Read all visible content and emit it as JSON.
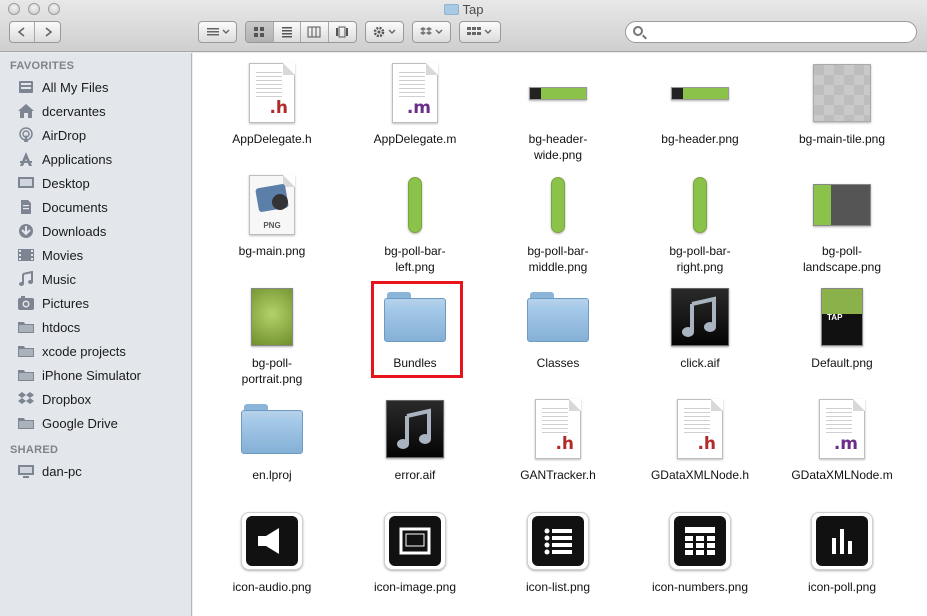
{
  "window": {
    "title": "Tap"
  },
  "toolbar": {
    "back_icon": "chevron-left-icon",
    "forward_icon": "chevron-right-icon",
    "arrange_icon": "list-arrange-icon",
    "view_modes": [
      "icon-view",
      "list-view",
      "column-view",
      "cover-flow-view"
    ],
    "action_icon": "gear-icon",
    "dropbox_icon": "dropbox-icon",
    "arrange_by_icon": "grid-arrange-icon",
    "search": {
      "placeholder": ""
    }
  },
  "sidebar": {
    "favorites_header": "FAVORITES",
    "favorites": [
      {
        "label": "All My Files",
        "icon": "all-files-icon"
      },
      {
        "label": "dcervantes",
        "icon": "home-icon"
      },
      {
        "label": "AirDrop",
        "icon": "airdrop-icon"
      },
      {
        "label": "Applications",
        "icon": "applications-icon"
      },
      {
        "label": "Desktop",
        "icon": "desktop-icon"
      },
      {
        "label": "Documents",
        "icon": "documents-icon"
      },
      {
        "label": "Downloads",
        "icon": "downloads-icon"
      },
      {
        "label": "Movies",
        "icon": "movies-icon"
      },
      {
        "label": "Music",
        "icon": "music-icon"
      },
      {
        "label": "Pictures",
        "icon": "pictures-icon"
      },
      {
        "label": "htdocs",
        "icon": "folder-icon"
      },
      {
        "label": "xcode projects",
        "icon": "folder-icon"
      },
      {
        "label": "iPhone Simulator",
        "icon": "folder-icon"
      },
      {
        "label": "Dropbox",
        "icon": "dropbox-icon"
      },
      {
        "label": "Google Drive",
        "icon": "folder-icon"
      }
    ],
    "shared_header": "SHARED",
    "shared": [
      {
        "label": "dan-pc",
        "icon": "computer-icon"
      }
    ]
  },
  "files": [
    {
      "line1": "AppDelegate.h",
      "line2": "",
      "kind": "header-file",
      "ext": ".h"
    },
    {
      "line1": "AppDelegate.m",
      "line2": "",
      "kind": "objc-file",
      "ext": ".m"
    },
    {
      "line1": "bg-header-",
      "line2": "wide.png",
      "kind": "image-header-wide"
    },
    {
      "line1": "bg-header.png",
      "line2": "",
      "kind": "image-header"
    },
    {
      "line1": "bg-main-tile.png",
      "line2": "",
      "kind": "image-tile"
    },
    {
      "line1": "bg-main.png",
      "line2": "",
      "kind": "png-preview"
    },
    {
      "line1": "bg-poll-bar-",
      "line2": "left.png",
      "kind": "image-bar"
    },
    {
      "line1": "bg-poll-bar-",
      "line2": "middle.png",
      "kind": "image-bar"
    },
    {
      "line1": "bg-poll-bar-",
      "line2": "right.png",
      "kind": "image-bar"
    },
    {
      "line1": "bg-poll-",
      "line2": "landscape.png",
      "kind": "image-landscape"
    },
    {
      "line1": "bg-poll-",
      "line2": "portrait.png",
      "kind": "image-portrait"
    },
    {
      "line1": "Bundles",
      "line2": "",
      "kind": "folder",
      "highlighted": true
    },
    {
      "line1": "Classes",
      "line2": "",
      "kind": "folder"
    },
    {
      "line1": "click.aif",
      "line2": "",
      "kind": "audio"
    },
    {
      "line1": "Default.png",
      "line2": "",
      "kind": "image-default",
      "badge": "TAP"
    },
    {
      "line1": "en.lproj",
      "line2": "",
      "kind": "folder"
    },
    {
      "line1": "error.aif",
      "line2": "",
      "kind": "audio"
    },
    {
      "line1": "GANTracker.h",
      "line2": "",
      "kind": "header-file",
      "ext": ".h"
    },
    {
      "line1": "GDataXMLNode.h",
      "line2": "",
      "kind": "header-file",
      "ext": ".h"
    },
    {
      "line1": "GDataXMLNode.m",
      "line2": "",
      "kind": "objc-file",
      "ext": ".m"
    },
    {
      "line1": "icon-audio.png",
      "line2": "",
      "kind": "icon-audio"
    },
    {
      "line1": "icon-image.png",
      "line2": "",
      "kind": "icon-image"
    },
    {
      "line1": "icon-list.png",
      "line2": "",
      "kind": "icon-list"
    },
    {
      "line1": "icon-numbers.png",
      "line2": "",
      "kind": "icon-numbers"
    },
    {
      "line1": "icon-poll.png",
      "line2": "",
      "kind": "icon-poll"
    }
  ],
  "thumb_labels": {
    "png_badge": "PNG",
    "tap_badge": "TAP"
  },
  "colors": {
    "h_ext": "#b22a2a",
    "m_ext": "#6b2d8a",
    "lime": "#8bc34a",
    "highlight": "#e8141b",
    "sidebar_bg": "#e3e7ec"
  }
}
